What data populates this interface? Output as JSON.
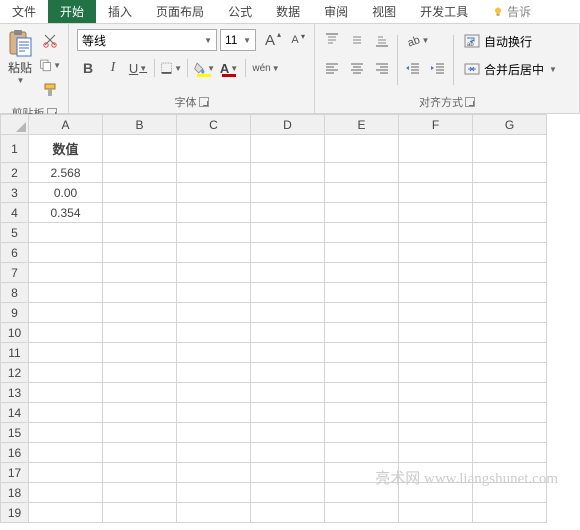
{
  "tabs": {
    "file": "文件",
    "home": "开始",
    "insert": "插入",
    "layout": "页面布局",
    "formula": "公式",
    "data": "数据",
    "review": "审阅",
    "view": "视图",
    "dev": "开发工具",
    "tell": "告诉"
  },
  "clipboard": {
    "paste": "粘贴",
    "group": "剪贴板"
  },
  "font": {
    "name": "等线",
    "size": "11",
    "wen": "wén",
    "group": "字体",
    "a_large": "A",
    "a_small": "A"
  },
  "align": {
    "wrap": "自动换行",
    "merge": "合并后居中",
    "group": "对齐方式"
  },
  "columns": [
    "A",
    "B",
    "C",
    "D",
    "E",
    "F",
    "G"
  ],
  "rows": [
    "1",
    "2",
    "3",
    "4",
    "5",
    "6",
    "7",
    "8",
    "9",
    "10",
    "11",
    "12",
    "13",
    "14",
    "15",
    "16",
    "17",
    "18",
    "19"
  ],
  "cells": {
    "A1": "数值",
    "A2": "2.568",
    "A3": "0.00",
    "A4": "0.354"
  },
  "watermark": "亮术网 www.liangshunet.com"
}
